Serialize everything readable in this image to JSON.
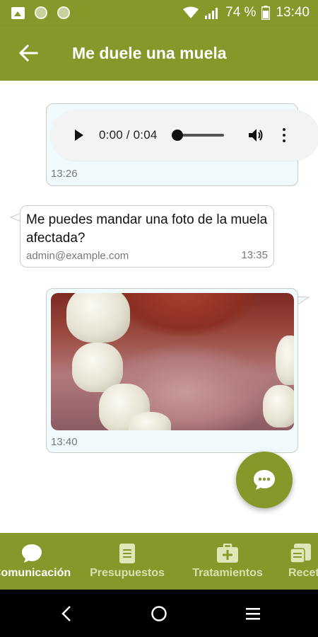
{
  "status_bar": {
    "battery": "74 %",
    "time": "13:40"
  },
  "app_bar": {
    "title": "Me duele una muela"
  },
  "messages": [
    {
      "type": "audio",
      "audio_time": "0:00 / 0:04",
      "progress": 0,
      "time": "13:26"
    },
    {
      "type": "text",
      "text": "Me puedes mandar una foto de la muela afectada?",
      "sender": "admin@example.com",
      "time": "13:35"
    },
    {
      "type": "image",
      "time": "13:40"
    }
  ],
  "bottom_nav": {
    "items": [
      {
        "label": "Comunicación",
        "icon": "chat-bubble-icon",
        "active": true
      },
      {
        "label": "Presupuestos",
        "icon": "document-icon",
        "active": false
      },
      {
        "label": "Tratamientos",
        "icon": "medical-kit-icon",
        "active": false
      },
      {
        "label": "Recetas",
        "icon": "prescription-icon",
        "active": false
      }
    ]
  },
  "colors": {
    "primary": "#86982a",
    "sent_bubble": "#f0fafc",
    "received_bubble": "#ffffff"
  }
}
